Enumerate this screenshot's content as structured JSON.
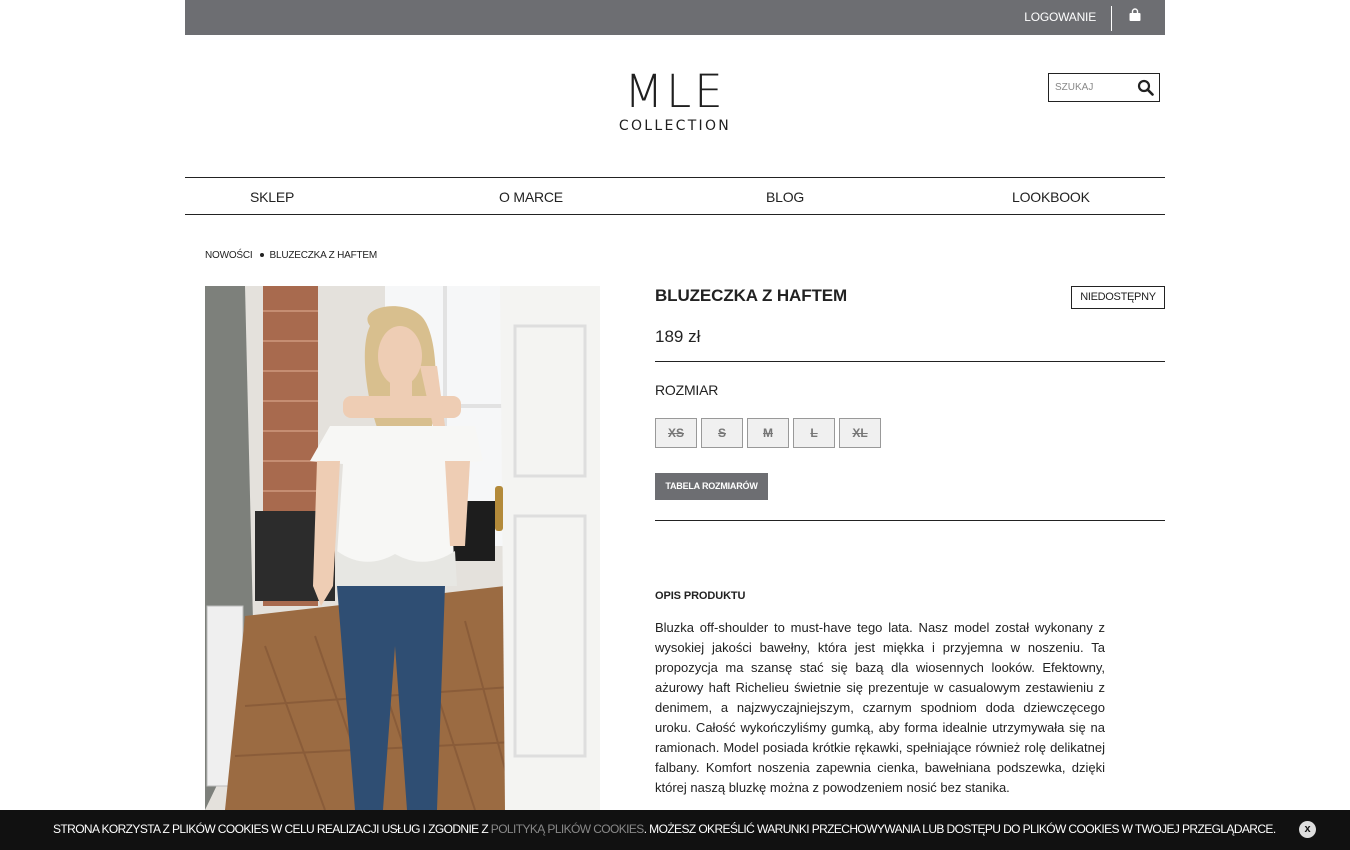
{
  "topbar": {
    "login_label": "LOGOWANIE",
    "cart_icon": "shopping-bag-icon"
  },
  "logo": {
    "main": "MLE",
    "sub": "COLLECTION"
  },
  "search": {
    "placeholder": "SZUKAJ",
    "icon": "search-icon"
  },
  "nav": {
    "items": [
      {
        "label": "SKLEP"
      },
      {
        "label": "O MARCE"
      },
      {
        "label": "BLOG"
      },
      {
        "label": "LOOKBOOK"
      }
    ]
  },
  "breadcrumb": {
    "items": [
      "NOWOŚCI",
      "BLUZECZKA Z HAFTEM"
    ]
  },
  "product": {
    "title": "BLUZECZKA Z HAFTEM",
    "availability": "NIEDOSTĘPNY",
    "price": "189 zł",
    "size_label": "ROZMIAR",
    "sizes": [
      "XS",
      "S",
      "M",
      "L",
      "XL"
    ],
    "size_chart_label": "TABELA ROZMIARÓW",
    "description_title": "OPIS PRODUKTU",
    "description": "Bluzka off-shoulder to must-have tego lata. Nasz model został wykonany z wysokiej jakości bawełny, która jest miękka i przyjemna w noszeniu. Ta propozycja ma szansę stać się bazą dla wiosennych looków. Efektowny, ażurowy haft Richelieu świetnie się prezentuje w casualowym zestawieniu z denimem, a najzwyczajniejszym, czarnym spodniom doda dziewczęcego uroku. Całość wykończyliśmy gumką, aby forma idealnie utrzymywała się na ramionach. Model posiada krótkie rękawki, spełniające również rolę delikatnej falbany. Komfort noszenia zapewnia cienka, bawełniana podszewka, dzięki której naszą bluzkę można z powodzeniem nosić bez stanika."
  },
  "cookie": {
    "text_before": "STRONA KORZYSTA Z PLIKÓW COOKIES W CELU REALIZACJI USŁUG I ZGODNIE Z ",
    "link": "POLITYKĄ PLIKÓW COOKIES",
    "text_after": ". MOŻESZ OKREŚLIĆ WARUNKI PRZECHOWYWANIA LUB DOSTĘPU DO PLIKÓW COOKIES W TWOJEJ PRZEGLĄDARCE.",
    "close_label": "x"
  },
  "colors": {
    "topbar": "#6d6e72",
    "cookie_bar": "#111111",
    "link_grey": "#888888"
  }
}
